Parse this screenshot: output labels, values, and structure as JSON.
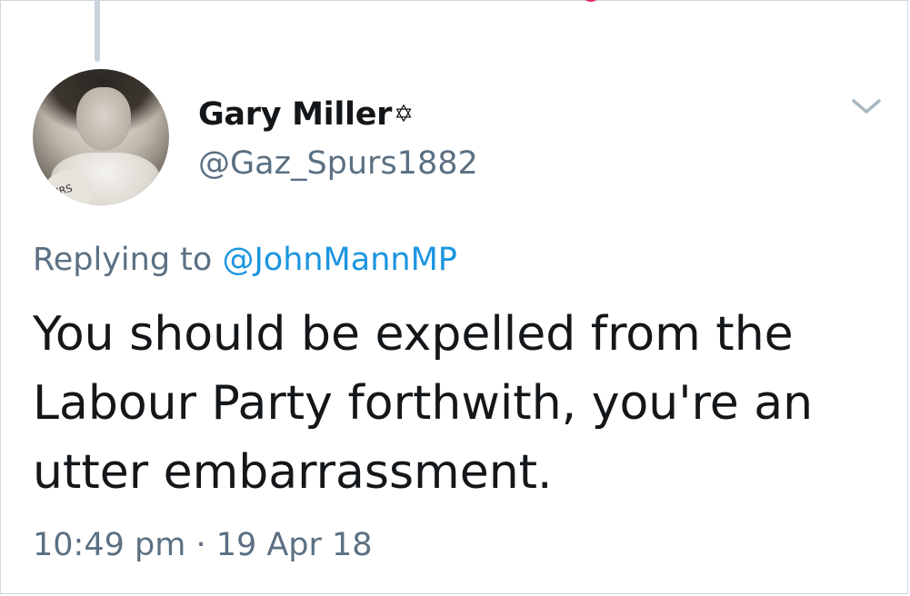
{
  "tweet": {
    "author": {
      "display_name": "Gary Miller",
      "name_badge": "✡",
      "handle": "@Gaz_Spurs1882",
      "avatar_badge_text": "URS"
    },
    "reply_prefix": "Replying to ",
    "reply_to": "@JohnMannMP",
    "text": "You should be expelled from the Labour Party forthwith, you're an utter embarrassment.",
    "time": "10:49 pm",
    "separator": " · ",
    "date": "19 Apr 18"
  },
  "icons": {
    "menu": "chevron-down-icon",
    "badge": "star-of-david-icon"
  },
  "colors": {
    "text": "#14171a",
    "secondary": "#5b7083",
    "link": "#1b95e0",
    "like": "#e0245e",
    "thread_line": "#c9d3da"
  }
}
